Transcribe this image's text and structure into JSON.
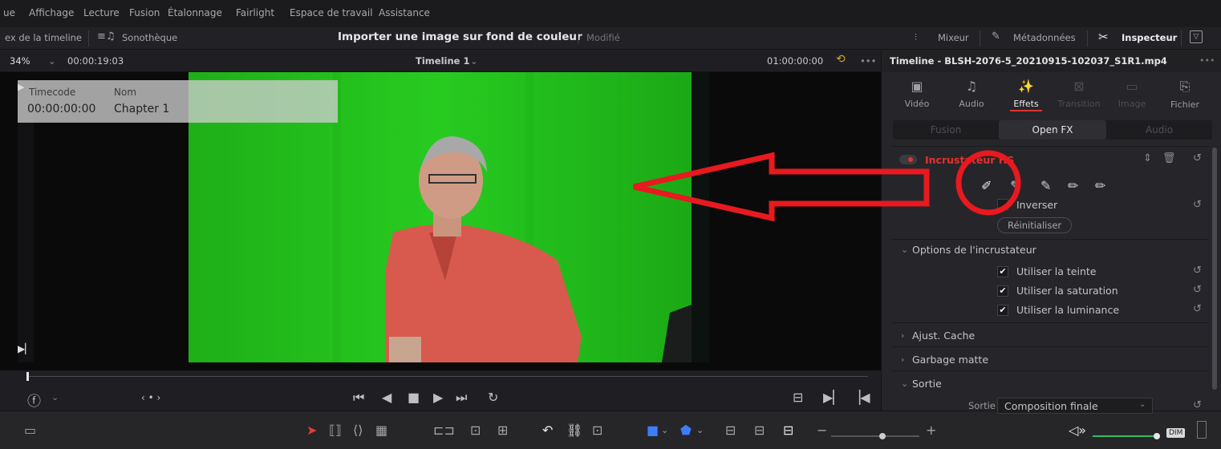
{
  "menu": [
    "ue",
    "Affichage",
    "Lecture",
    "Fusion",
    "Étalonnage",
    "Fairlight",
    "Espace de travail",
    "Assistance"
  ],
  "toolbar": {
    "left_tab": "ex de la timeline",
    "sound_library": "Sonothèque",
    "project_title": "Importer une image sur fond de couleur",
    "modified": "Modifié",
    "mixer": "Mixeur",
    "metadata": "Métadonnées",
    "inspector": "Inspecteur"
  },
  "viewer": {
    "zoom": "34%",
    "timecode_left": "00:00:19:03",
    "timeline_name": "Timeline 1",
    "timecode_right": "01:00:00:00"
  },
  "chapter": {
    "timecode_header": "Timecode",
    "name_header": "Nom",
    "timecode_value": "00:00:00:00",
    "name_value": "Chapter 1"
  },
  "inspector": {
    "title": "Timeline - BLSH-2076-5_20210915-102037_S1R1.mp4",
    "tabs": [
      {
        "label": "Vidéo",
        "icon": "video-icon"
      },
      {
        "label": "Audio",
        "icon": "audio-icon"
      },
      {
        "label": "Effets",
        "icon": "effects-icon"
      },
      {
        "label": "Transition",
        "icon": "transition-icon"
      },
      {
        "label": "Image",
        "icon": "image-icon"
      },
      {
        "label": "Fichier",
        "icon": "file-icon"
      }
    ],
    "subtabs": [
      "Fusion",
      "Open FX",
      "Audio"
    ],
    "effect_name": "Incrustateur HS",
    "invert_label": "Inverser",
    "reset_button": "Réinitialiser",
    "options_header": "Options de l'incrustateur",
    "options": [
      "Utiliser la teinte",
      "Utiliser la saturation",
      "Utiliser la luminance"
    ],
    "mask_adjust": "Ajust. Cache",
    "garbage_matte": "Garbage matte",
    "output_header": "Sortie",
    "output_label": "Sortie",
    "output_value": "Composition finale"
  },
  "colors": {
    "accent_red": "#e0322f",
    "green_screen": "#22c21b",
    "annotation_red": "#e8191f"
  }
}
